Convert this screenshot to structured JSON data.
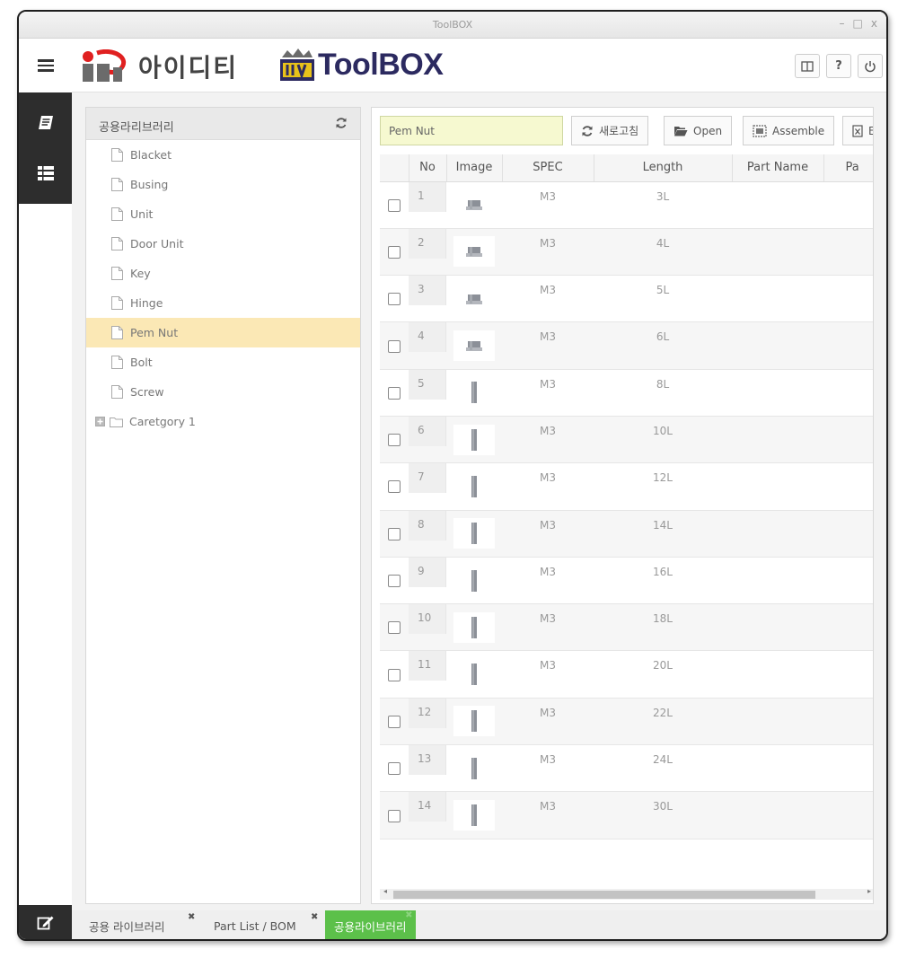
{
  "window": {
    "title": "ToolBOX",
    "controls": [
      "–",
      "□",
      "x"
    ]
  },
  "header": {
    "logo_ideti_text": "아이디티",
    "logo_toolbox_text": "ToolBOX",
    "buttons": [
      {
        "name": "layout-icon",
        "label": ""
      },
      {
        "name": "help-icon",
        "label": "?"
      },
      {
        "name": "power-icon",
        "label": ""
      }
    ]
  },
  "left_nav": {
    "items": [
      "book-icon",
      "list-icon"
    ],
    "bottom": "edit-icon"
  },
  "tree": {
    "title": "공용라리브러리",
    "items": [
      {
        "label": "Blacket",
        "type": "file"
      },
      {
        "label": "Busing",
        "type": "file"
      },
      {
        "label": "Unit",
        "type": "file"
      },
      {
        "label": "Door Unit",
        "type": "file"
      },
      {
        "label": "Key",
        "type": "file"
      },
      {
        "label": "Hinge",
        "type": "file"
      },
      {
        "label": "Pem Nut",
        "type": "file",
        "selected": true
      },
      {
        "label": "Bolt",
        "type": "file"
      },
      {
        "label": "Screw",
        "type": "file"
      },
      {
        "label": "Caretgory 1",
        "type": "folder"
      }
    ]
  },
  "grid": {
    "search_value": "Pem Nut",
    "toolbar": {
      "refresh_label": "새로고침",
      "open_label": "Open",
      "assemble_label": "Assemble",
      "excel_label": "E"
    },
    "columns": [
      "",
      "No",
      "Image",
      "SPEC",
      "Length",
      "Part Name",
      "Pa"
    ],
    "rows": [
      {
        "no": "1",
        "spec": "M3",
        "length": "3L"
      },
      {
        "no": "2",
        "spec": "M3",
        "length": "4L"
      },
      {
        "no": "3",
        "spec": "M3",
        "length": "5L"
      },
      {
        "no": "4",
        "spec": "M3",
        "length": "6L"
      },
      {
        "no": "5",
        "spec": "M3",
        "length": "8L"
      },
      {
        "no": "6",
        "spec": "M3",
        "length": "10L"
      },
      {
        "no": "7",
        "spec": "M3",
        "length": "12L"
      },
      {
        "no": "8",
        "spec": "M3",
        "length": "14L"
      },
      {
        "no": "9",
        "spec": "M3",
        "length": "16L"
      },
      {
        "no": "10",
        "spec": "M3",
        "length": "18L"
      },
      {
        "no": "11",
        "spec": "M3",
        "length": "20L"
      },
      {
        "no": "12",
        "spec": "M3",
        "length": "22L"
      },
      {
        "no": "13",
        "spec": "M3",
        "length": "24L"
      },
      {
        "no": "14",
        "spec": "M3",
        "length": "30L"
      }
    ]
  },
  "bottom_tabs": [
    {
      "label": "공용 라이브러리",
      "closable": true,
      "active": false
    },
    {
      "label": "Part List / BOM",
      "closable": true,
      "active": false
    },
    {
      "label": "공용라이브러리",
      "closable": true,
      "active": true
    }
  ],
  "colors": {
    "accent_green": "#5cc04a",
    "selected_row": "#fbe8b5",
    "search_bg": "#f6f9d0",
    "nav_dark": "#2d2d2d",
    "toolbox_navy": "#2c2a60"
  }
}
